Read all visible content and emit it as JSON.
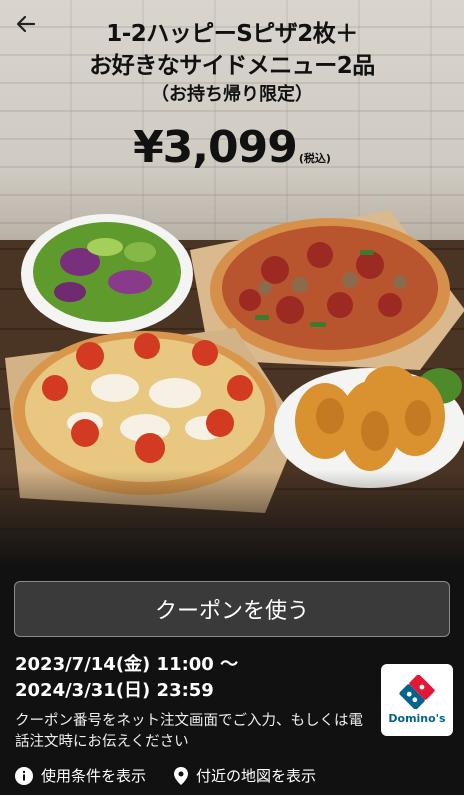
{
  "header": {
    "back_icon": "arrow-left-icon",
    "title_line1": "1-2ハッピーSピザ2枚＋",
    "title_line2": "お好きなサイドメニュー2品",
    "title_line3": "（お持ち帰り限定）"
  },
  "price": {
    "amount": "¥3,099",
    "tax_note": "(税込)"
  },
  "coupon": {
    "use_button_label": "クーポンを使う",
    "valid_from": "2023/7/14(金) 11:00 〜",
    "valid_to": "2024/3/31(日) 23:59",
    "instructions": "クーポン番号をネット注文画面でご入力、もしくは電話注文時にお伝えください"
  },
  "brand": {
    "logo_text": "Domino's",
    "colors": {
      "blue": "#006491",
      "red": "#e31837"
    }
  },
  "footer_links": {
    "terms": {
      "icon": "info-icon",
      "label": "使用条件を表示"
    },
    "map": {
      "icon": "map-pin-icon",
      "label": "付近の地図を表示"
    }
  }
}
